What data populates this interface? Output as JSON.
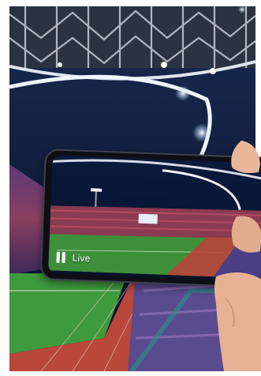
{
  "overlay": {
    "status_label": "Live",
    "control_icon": "pause-icon"
  },
  "colors": {
    "night_sky": "#0b1630",
    "floodlight": "#e9f3ff",
    "pitch": "#3f9a3e",
    "running_track": "#b9473a",
    "phone_body": "#0d0f14"
  }
}
